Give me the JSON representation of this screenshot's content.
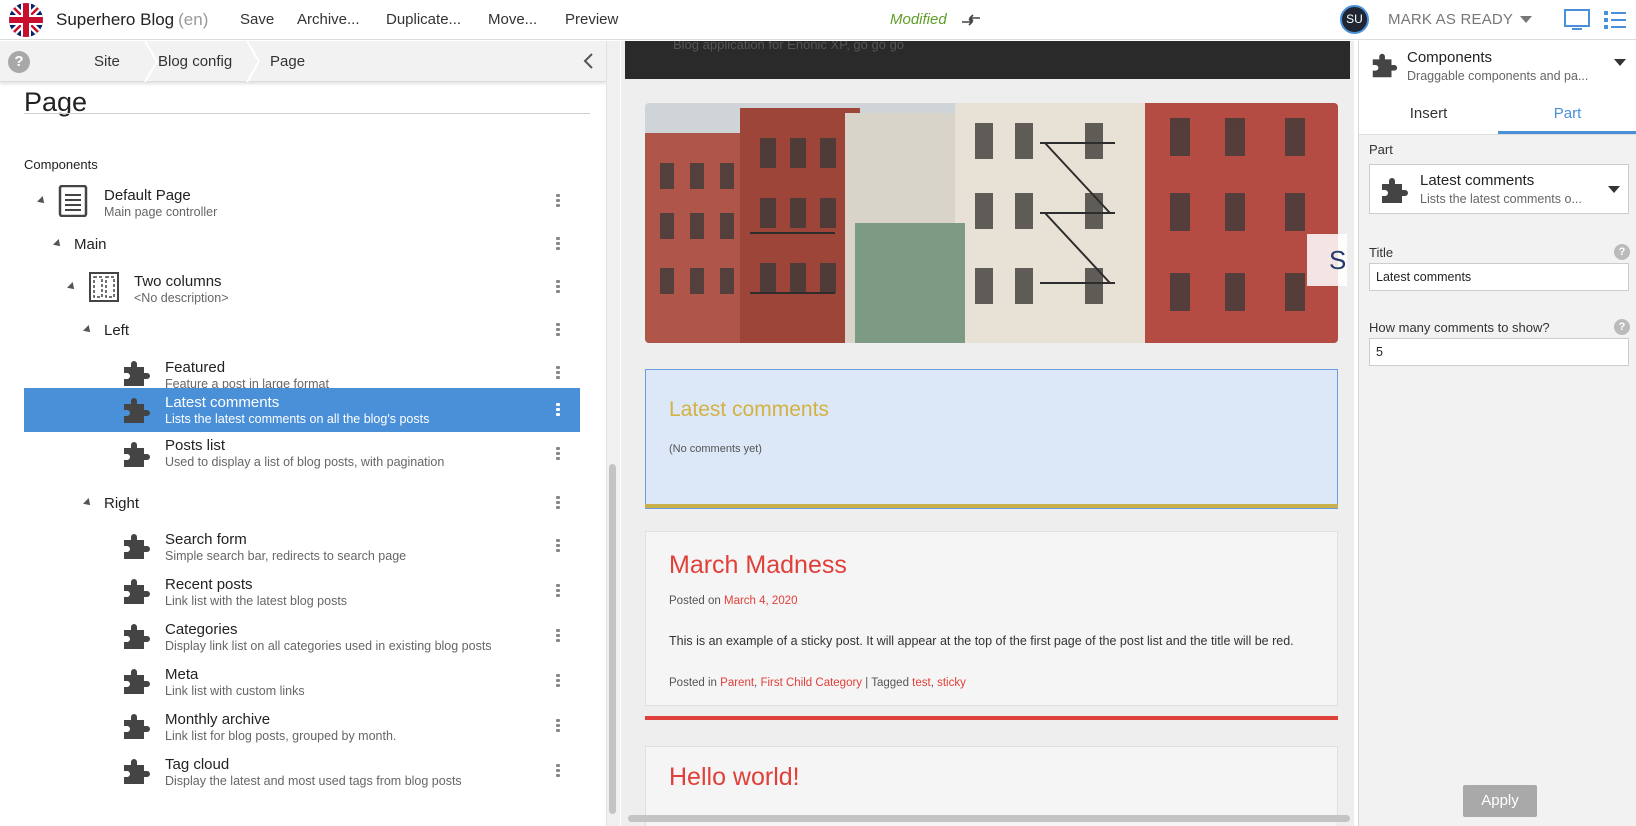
{
  "app": {
    "name": "Superhero Blog",
    "lang": "(en)",
    "status": "Modified",
    "user_initials": "SU",
    "mark_ready_label": "MARK AS READY"
  },
  "toolbar": {
    "save": "Save",
    "archive": "Archive...",
    "duplicate": "Duplicate...",
    "move": "Move...",
    "preview": "Preview"
  },
  "breadcrumb": {
    "help": "?",
    "items": [
      "Site",
      "Blog config",
      "Page"
    ]
  },
  "page": {
    "title": "Page",
    "components_label": "Components"
  },
  "tree": {
    "default_page": {
      "title": "Default Page",
      "desc": "Main page controller"
    },
    "main": "Main",
    "two_columns": {
      "title": "Two columns",
      "desc": "<No description>"
    },
    "left": "Left",
    "left_items": [
      {
        "title": "Featured",
        "desc": "Feature a post in large format"
      },
      {
        "title": "Latest comments",
        "desc": "Lists the latest comments on all the blog's posts"
      },
      {
        "title": "Posts list",
        "desc": "Used to display a list of blog posts, with pagination"
      }
    ],
    "right": "Right",
    "right_items": [
      {
        "title": "Search form",
        "desc": "Simple search bar, redirects to search page"
      },
      {
        "title": "Recent posts",
        "desc": "Link list with the latest blog posts"
      },
      {
        "title": "Categories",
        "desc": "Display link list on all categories used in existing blog posts"
      },
      {
        "title": "Meta",
        "desc": "Link list with custom links"
      },
      {
        "title": "Monthly archive",
        "desc": "Link list for blog posts, grouped by month."
      },
      {
        "title": "Tag cloud",
        "desc": "Display the latest and most used tags from blog posts"
      }
    ]
  },
  "preview": {
    "header_text": "Blog application for Enonic XP, go go go",
    "hero_letter": "S",
    "latest_comments": {
      "title": "Latest comments",
      "empty": "(No comments yet)"
    },
    "posts": [
      {
        "title": "March Madness",
        "posted_on_label": "Posted on",
        "date": "March 4, 2020",
        "body": "This is an example of a sticky post. It will appear at the top of the first page of the post list and the title will be red.",
        "posted_in_label": "Posted in",
        "categories": [
          "Parent",
          "First Child Category"
        ],
        "tagged_label": "Tagged",
        "tags": [
          "test",
          "sticky"
        ]
      },
      {
        "title": "Hello world!"
      }
    ]
  },
  "inspect": {
    "header": {
      "title": "Components",
      "subtitle": "Draggable components and pa..."
    },
    "tabs": [
      "Insert",
      "Part"
    ],
    "part_label": "Part",
    "part": {
      "title": "Latest comments",
      "subtitle": "Lists the latest comments o..."
    },
    "title_label": "Title",
    "title_value": "Latest comments",
    "count_label": "How many comments to show?",
    "count_value": "5",
    "apply": "Apply"
  },
  "colors": {
    "accent": "#4a90d9",
    "modified": "#609e2a",
    "post_title": "#e0403a",
    "comments_title": "#d3b242"
  }
}
